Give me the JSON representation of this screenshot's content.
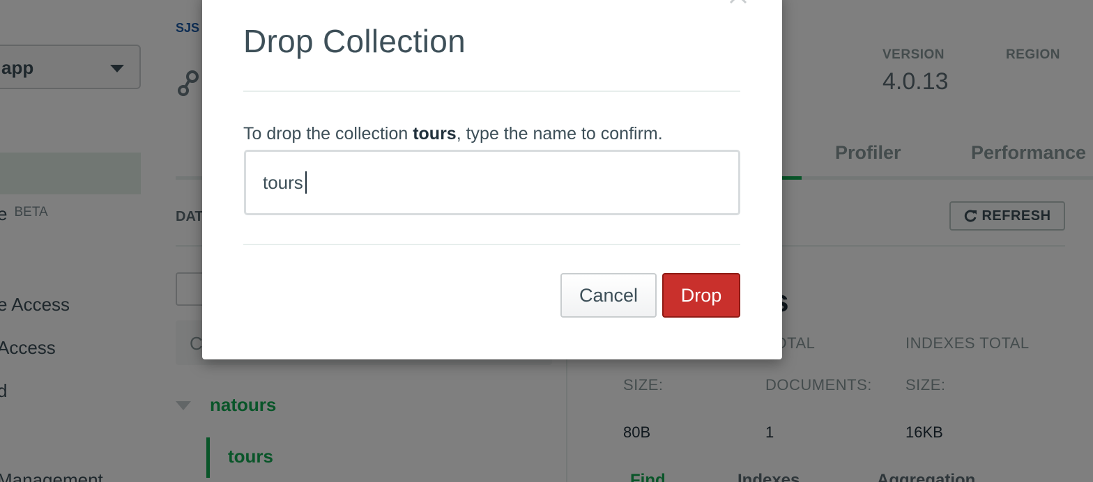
{
  "background": {
    "sidebar": {
      "project_select_label": "app",
      "beta_item_tail": "e",
      "beta_badge": "BETA",
      "items": [
        "e Access",
        "Access",
        "d",
        "Management"
      ]
    },
    "breadcrumb": "SJS",
    "version_label": "VERSION",
    "version_value": "4.0.13",
    "region_label": "REGION",
    "tabs": [
      "Profiler",
      "Performance"
    ],
    "databases_label_fragment": "DAT",
    "refresh_label": "REFRESH",
    "search_fragment": "C",
    "database_name": "natours",
    "collection_name": "tours",
    "collection_title_fragment": "rs",
    "stats": {
      "labels_row1": [
        "TOTAL",
        "INDEXES TOTAL"
      ],
      "labels_row2": [
        "SIZE:",
        "DOCUMENTS:",
        "SIZE:"
      ],
      "values": [
        "80B",
        "1",
        "16KB"
      ]
    },
    "subtabs": [
      "Find",
      "Indexes",
      "Aggregation"
    ]
  },
  "modal": {
    "title": "Drop Collection",
    "message_prefix": "To drop the collection ",
    "message_collection": "tours",
    "message_suffix": ", type the name to confirm.",
    "input_value": "tours",
    "cancel_label": "Cancel",
    "drop_label": "Drop"
  },
  "colors": {
    "accent_green": "#13aa52",
    "danger_red": "#c9302c",
    "link_blue": "#1a5ba8"
  },
  "icons": [
    "caret-down-icon",
    "cluster-icon",
    "refresh-icon",
    "close-icon",
    "collapse-caret-icon"
  ]
}
